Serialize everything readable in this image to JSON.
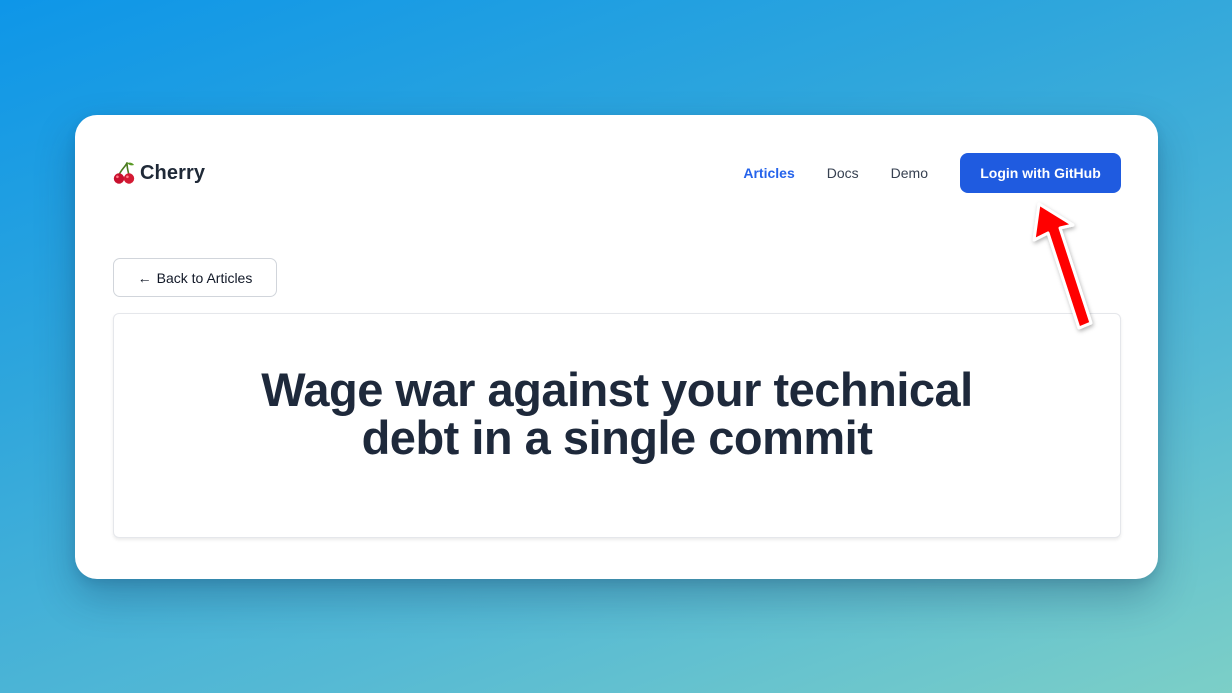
{
  "app": {
    "brand_name": "Cherry",
    "brand_icon": "cherry-icon"
  },
  "nav": {
    "links": [
      {
        "label": "Articles",
        "active": true
      },
      {
        "label": "Docs",
        "active": false
      },
      {
        "label": "Demo",
        "active": false
      }
    ],
    "login_label": "Login with GitHub"
  },
  "article": {
    "back_label": "Back to Articles",
    "back_icon": "arrow-left-icon",
    "title": "Wage war against your technical debt in a single commit"
  },
  "annotation": {
    "icon": "red-arrow-icon",
    "points_to": "login-with-github-button"
  },
  "colors": {
    "accent": "#2563eb",
    "button_bg": "#1f5be0",
    "title_text": "#1e293b",
    "annotation": "#ff0000"
  }
}
